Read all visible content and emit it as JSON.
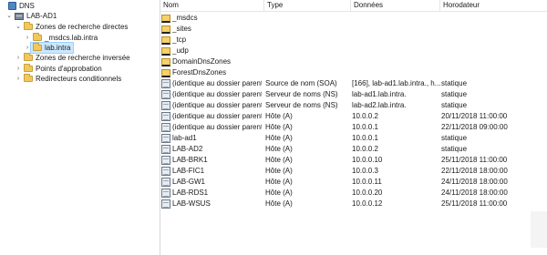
{
  "tree": [
    {
      "label": "DNS",
      "expander": "",
      "icon": "dns"
    },
    {
      "label": "LAB-AD1",
      "expander": "⌄",
      "icon": "server"
    },
    {
      "label": "Zones de recherche directes",
      "expander": "⌄",
      "icon": "folder"
    },
    {
      "label": "_msdcs.lab.intra",
      "expander": "›",
      "icon": "folder"
    },
    {
      "label": "lab.intra",
      "expander": "›",
      "icon": "folder",
      "selected": true
    },
    {
      "label": "Zones de recherche inversée",
      "expander": "›",
      "icon": "folder"
    },
    {
      "label": "Points d'approbation",
      "expander": "›",
      "icon": "folder"
    },
    {
      "label": "Redirecteurs conditionnels",
      "expander": "›",
      "icon": "folder"
    }
  ],
  "columns": {
    "name": "Nom",
    "type": "Type",
    "data": "Données",
    "timestamp": "Horodateur"
  },
  "records": [
    {
      "name": "_msdcs",
      "type": "",
      "data": "",
      "timestamp": "",
      "icon": "folder"
    },
    {
      "name": "_sites",
      "type": "",
      "data": "",
      "timestamp": "",
      "icon": "folder"
    },
    {
      "name": "_tcp",
      "type": "",
      "data": "",
      "timestamp": "",
      "icon": "folder"
    },
    {
      "name": "_udp",
      "type": "",
      "data": "",
      "timestamp": "",
      "icon": "folder"
    },
    {
      "name": "DomainDnsZones",
      "type": "",
      "data": "",
      "timestamp": "",
      "icon": "folder"
    },
    {
      "name": "ForestDnsZones",
      "type": "",
      "data": "",
      "timestamp": "",
      "icon": "folder"
    },
    {
      "name": "(identique au dossier parent)",
      "type": "Source de nom (SOA)",
      "data": "[166], lab-ad1.lab.intra., h...",
      "timestamp": "statique",
      "icon": "record"
    },
    {
      "name": "(identique au dossier parent)",
      "type": "Serveur de noms (NS)",
      "data": "lab-ad1.lab.intra.",
      "timestamp": "statique",
      "icon": "record"
    },
    {
      "name": "(identique au dossier parent)",
      "type": "Serveur de noms (NS)",
      "data": "lab-ad2.lab.intra.",
      "timestamp": "statique",
      "icon": "record"
    },
    {
      "name": "(identique au dossier parent)",
      "type": "Hôte (A)",
      "data": "10.0.0.2",
      "timestamp": "20/11/2018 11:00:00",
      "icon": "record"
    },
    {
      "name": "(identique au dossier parent)",
      "type": "Hôte (A)",
      "data": "10.0.0.1",
      "timestamp": "22/11/2018 09:00:00",
      "icon": "record"
    },
    {
      "name": "lab-ad1",
      "type": "Hôte (A)",
      "data": "10.0.0.1",
      "timestamp": "statique",
      "icon": "record"
    },
    {
      "name": "LAB-AD2",
      "type": "Hôte (A)",
      "data": "10.0.0.2",
      "timestamp": "statique",
      "icon": "record"
    },
    {
      "name": "LAB-BRK1",
      "type": "Hôte (A)",
      "data": "10.0.0.10",
      "timestamp": "25/11/2018 11:00:00",
      "icon": "record"
    },
    {
      "name": "LAB-FIC1",
      "type": "Hôte (A)",
      "data": "10.0.0.3",
      "timestamp": "22/11/2018 18:00:00",
      "icon": "record"
    },
    {
      "name": "LAB-GW1",
      "type": "Hôte (A)",
      "data": "10.0.0.11",
      "timestamp": "24/11/2018 18:00:00",
      "icon": "record"
    },
    {
      "name": "LAB-RDS1",
      "type": "Hôte (A)",
      "data": "10.0.0.20",
      "timestamp": "24/11/2018 18:00:00",
      "icon": "record"
    },
    {
      "name": "LAB-WSUS",
      "type": "Hôte (A)",
      "data": "10.0.0.12",
      "timestamp": "25/11/2018 11:00:00",
      "icon": "record"
    }
  ]
}
